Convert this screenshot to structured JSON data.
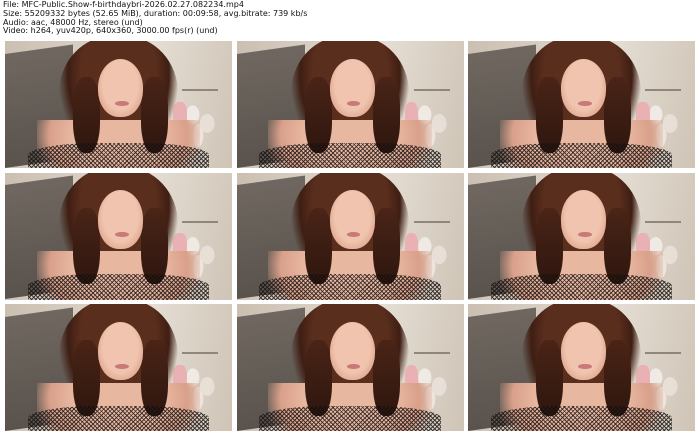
{
  "file_info": {
    "line1": "File: MFC-Public.Show-f-birthdaybri-2026.02.27.082234.mp4",
    "line2": "Size: 55209332 bytes (52.65 MiB), duration: 00:09:58, avg.bitrate: 739 kb/s",
    "line3": "Audio: aac, 48000 Hz, stereo (und)",
    "line4": "Video: h264, yuv420p, 640x360, 3000.00 fps(r) (und)"
  },
  "thumbnails": [
    {
      "name": "thumb-1"
    },
    {
      "name": "thumb-2"
    },
    {
      "name": "thumb-3"
    },
    {
      "name": "thumb-4"
    },
    {
      "name": "thumb-5"
    },
    {
      "name": "thumb-6"
    },
    {
      "name": "thumb-7"
    },
    {
      "name": "thumb-8"
    },
    {
      "name": "thumb-9"
    }
  ]
}
